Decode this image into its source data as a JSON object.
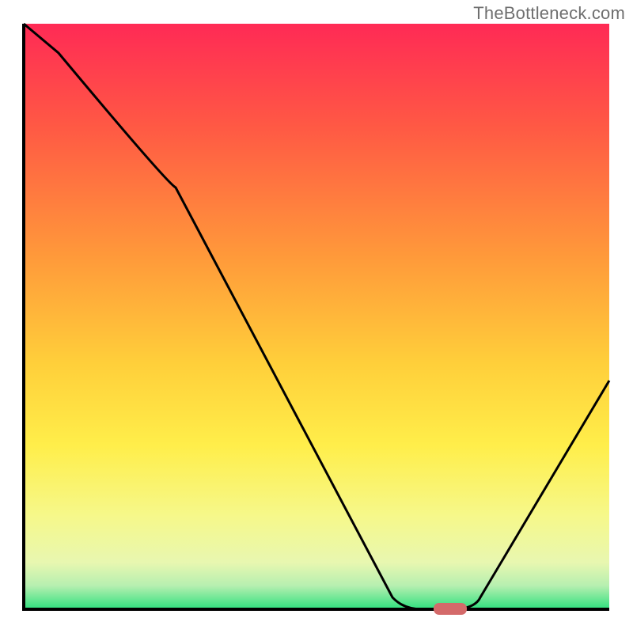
{
  "watermark": "TheBottleneck.com",
  "colors": {
    "gradient_top": "#ff2a55",
    "gradient_mid1": "#ff6a3c",
    "gradient_mid2": "#ffb03a",
    "gradient_mid3": "#ffe23a",
    "gradient_mid4": "#f7f97a",
    "gradient_bottom_band_top": "#d9f7a8",
    "gradient_bottom_band_bottom": "#2fe07e",
    "axis": "#000000",
    "curve": "#000000",
    "marker": "#d46a6a"
  },
  "chart_data": {
    "type": "line",
    "title": "",
    "xlabel": "",
    "ylabel": "",
    "xlim": [
      0,
      100
    ],
    "ylim": [
      0,
      100
    ],
    "series": [
      {
        "name": "bottleneck-curve",
        "x": [
          0,
          6,
          26,
          63,
          68,
          73,
          78,
          100
        ],
        "values": [
          100,
          95,
          72,
          2,
          0,
          0,
          2,
          39
        ]
      }
    ],
    "annotations": [
      {
        "name": "optimal-marker",
        "x_range": [
          70,
          75
        ],
        "y": 0
      }
    ]
  }
}
